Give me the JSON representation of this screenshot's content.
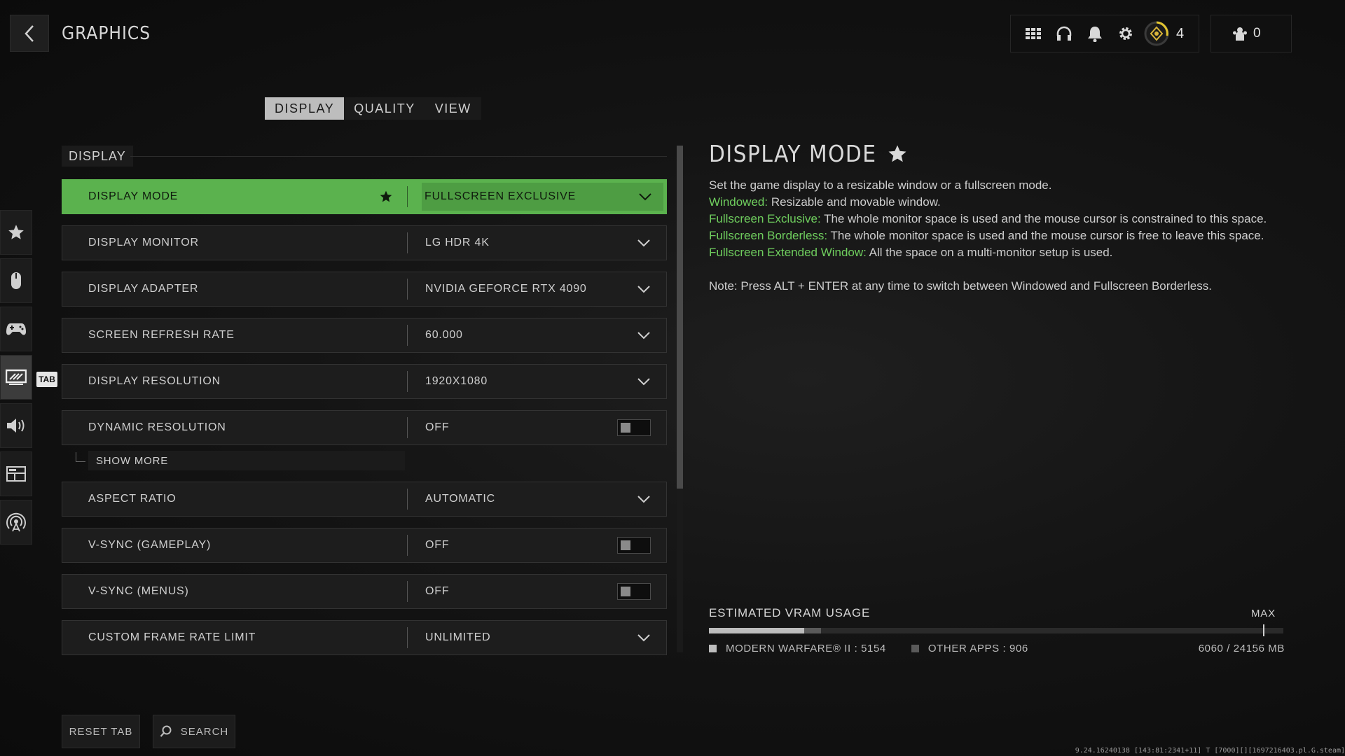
{
  "header": {
    "title": "GRAPHICS",
    "level": "4",
    "party_count": "0"
  },
  "tabs": [
    {
      "label": "DISPLAY",
      "active": true
    },
    {
      "label": "QUALITY",
      "active": false
    },
    {
      "label": "VIEW",
      "active": false
    }
  ],
  "rail": {
    "items": [
      "star-icon",
      "mouse-icon",
      "controller-icon",
      "monitor-icon",
      "speaker-icon",
      "interface-icon",
      "network-icon"
    ],
    "active_index": 3,
    "tab_hint": "TAB"
  },
  "section": {
    "title": "DISPLAY",
    "show_more": "SHOW MORE"
  },
  "settings": [
    {
      "label": "DISPLAY MODE",
      "value": "FULLSCREEN EXCLUSIVE",
      "type": "dropdown",
      "active": true
    },
    {
      "label": "DISPLAY MONITOR",
      "value": "LG HDR 4K",
      "type": "dropdown"
    },
    {
      "label": "DISPLAY ADAPTER",
      "value": "NVIDIA GEFORCE RTX 4090",
      "type": "dropdown"
    },
    {
      "label": "SCREEN REFRESH RATE",
      "value": "60.000",
      "type": "dropdown"
    },
    {
      "label": "DISPLAY RESOLUTION",
      "value": "1920X1080",
      "type": "dropdown"
    },
    {
      "label": "DYNAMIC RESOLUTION",
      "value": "OFF",
      "type": "toggle"
    },
    {
      "label": "ASPECT RATIO",
      "value": "AUTOMATIC",
      "type": "dropdown"
    },
    {
      "label": "V-SYNC (GAMEPLAY)",
      "value": "OFF",
      "type": "toggle"
    },
    {
      "label": "V-SYNC (MENUS)",
      "value": "OFF",
      "type": "toggle"
    },
    {
      "label": "CUSTOM FRAME RATE LIMIT",
      "value": "UNLIMITED",
      "type": "dropdown"
    }
  ],
  "description": {
    "title": "DISPLAY MODE",
    "intro": "Set the game display to a resizable window or a fullscreen mode.",
    "items": [
      {
        "term": "Windowed:",
        "text": " Resizable and movable window."
      },
      {
        "term": "Fullscreen Exclusive:",
        "text": " The whole monitor space is used and the mouse cursor is constrained to this space."
      },
      {
        "term": "Fullscreen Borderless:",
        "text": " The whole monitor space is used and the mouse cursor is free to leave this space."
      },
      {
        "term": "Fullscreen Extended Window:",
        "text": " All the space on a multi-monitor setup is used."
      }
    ],
    "note": "Note: Press ALT + ENTER at any time to switch between Windowed and Fullscreen Borderless."
  },
  "vram": {
    "title": "ESTIMATED VRAM USAGE",
    "max_label": "MAX",
    "mw_label": "MODERN WARFARE® II : 5154",
    "other_label": "OTHER APPS : 906",
    "total": "6060 / 24156 MB",
    "mw_mb": 5154,
    "other_mb": 906,
    "total_mb": 24156,
    "max_fraction": 0.965
  },
  "bottom": {
    "reset": "RESET TAB",
    "search": "SEARCH"
  },
  "build_info": "9.24.16240138 [143:81:2341+11] T [7000][][1697216403.pl.G.steam]",
  "colors": {
    "accent": "#5bb24e",
    "highlight_text": "#6fce5e"
  }
}
